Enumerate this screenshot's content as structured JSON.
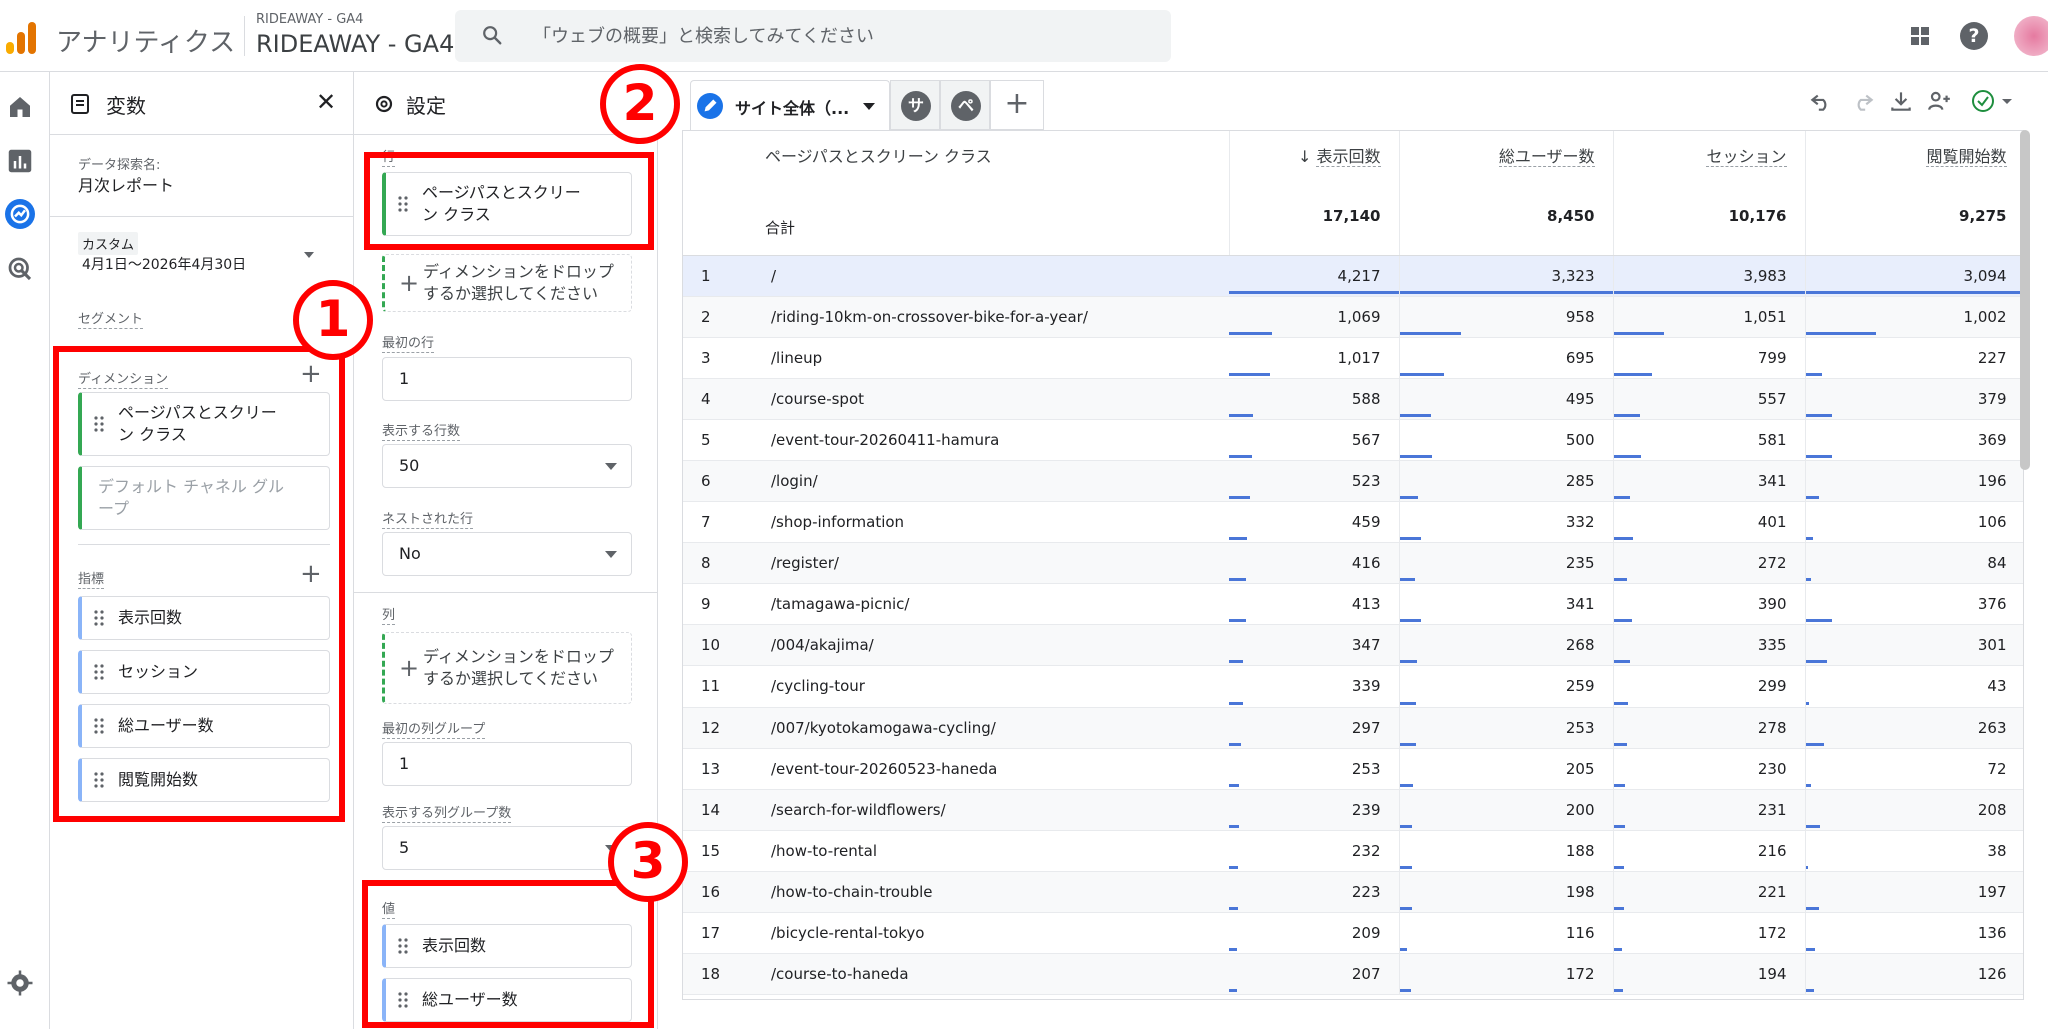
{
  "header": {
    "product_name": "アナリティクス",
    "property_small": "RIDEAWAY - GA4",
    "property_big": "RIDEAWAY - GA4",
    "search_placeholder": "「ウェブの概要」と検索してみてください",
    "help_glyph": "?",
    "logo_colors": [
      "#f9ab00",
      "#e37400",
      "#e37400"
    ]
  },
  "variables": {
    "title": "変数",
    "close_glyph": "✕",
    "exploration_name_label": "データ探索名:",
    "exploration_name": "月次レポート",
    "date_label": "カスタム",
    "date_range": "4月1日〜2026年4月30日",
    "segment_label": "セグメント",
    "dimensions_label": "ディメンション",
    "dimensions": [
      "ページパスとスクリー\nン クラス",
      "デフォルト チャネル グル\nープ"
    ],
    "metrics_label": "指標",
    "metrics": [
      "表示回数",
      "セッション",
      "総ユーザー数",
      "閲覧開始数"
    ]
  },
  "settings": {
    "title": "設定",
    "rows_label": "行",
    "rows_chip": "ページパスとスクリー\nン クラス",
    "drop_text": "ディメンションをドロップ\nするか選択してください",
    "first_row_label": "最初の行",
    "first_row_value": "1",
    "show_rows_label": "表示する行数",
    "show_rows_value": "50",
    "nested_label": "ネストされた行",
    "nested_value": "No",
    "columns_label": "列",
    "columns_drop_text": "ディメンションをドロップ\nするか選択してください",
    "first_col_group_label": "最初の列グループ",
    "first_col_group_value": "1",
    "show_col_groups_label": "表示する列グループ数",
    "show_col_groups_value": "5",
    "values_label": "値",
    "values": [
      "表示回数",
      "総ユーザー数"
    ]
  },
  "annotations": {
    "badge1": "1",
    "badge2": "2",
    "badge3": "3",
    "color": "#ff0000"
  },
  "tabs": {
    "main_label": "サイト全体（...",
    "tab2_glyph": "サ",
    "tab3_glyph": "ペ",
    "add_glyph": "+"
  },
  "table": {
    "dimension_header": "ページパスとスクリーン クラス",
    "total_label": "合計",
    "metric_headers": [
      "表示回数",
      "総ユーザー数",
      "セッション",
      "閲覧開始数"
    ],
    "sort_arrow": "↓",
    "totals": [
      "17,140",
      "8,450",
      "10,176",
      "9,275"
    ],
    "rows": [
      {
        "i": "1",
        "path": "/",
        "v": [
          "4,217",
          "3,323",
          "3,983",
          "3,094"
        ]
      },
      {
        "i": "2",
        "path": "/riding-10km-on-crossover-bike-for-a-year/",
        "v": [
          "1,069",
          "958",
          "1,051",
          "1,002"
        ]
      },
      {
        "i": "3",
        "path": "/lineup",
        "v": [
          "1,017",
          "695",
          "799",
          "227"
        ]
      },
      {
        "i": "4",
        "path": "/course-spot",
        "v": [
          "588",
          "495",
          "557",
          "379"
        ]
      },
      {
        "i": "5",
        "path": "/event-tour-20260411-hamura",
        "v": [
          "567",
          "500",
          "581",
          "369"
        ]
      },
      {
        "i": "6",
        "path": "/login/",
        "v": [
          "523",
          "285",
          "341",
          "196"
        ]
      },
      {
        "i": "7",
        "path": "/shop-information",
        "v": [
          "459",
          "332",
          "401",
          "106"
        ]
      },
      {
        "i": "8",
        "path": "/register/",
        "v": [
          "416",
          "235",
          "272",
          "84"
        ]
      },
      {
        "i": "9",
        "path": "/tamagawa-picnic/",
        "v": [
          "413",
          "341",
          "390",
          "376"
        ]
      },
      {
        "i": "10",
        "path": "/004/akajima/",
        "v": [
          "347",
          "268",
          "335",
          "301"
        ]
      },
      {
        "i": "11",
        "path": "/cycling-tour",
        "v": [
          "339",
          "259",
          "299",
          "43"
        ]
      },
      {
        "i": "12",
        "path": "/007/kyotokamogawa-cycling/",
        "v": [
          "297",
          "253",
          "278",
          "263"
        ]
      },
      {
        "i": "13",
        "path": "/event-tour-20260523-haneda",
        "v": [
          "253",
          "205",
          "230",
          "72"
        ]
      },
      {
        "i": "14",
        "path": "/search-for-wildflowers/",
        "v": [
          "239",
          "200",
          "231",
          "208"
        ]
      },
      {
        "i": "15",
        "path": "/how-to-rental",
        "v": [
          "232",
          "188",
          "216",
          "38"
        ]
      },
      {
        "i": "16",
        "path": "/how-to-chain-trouble",
        "v": [
          "223",
          "198",
          "221",
          "197"
        ]
      },
      {
        "i": "17",
        "path": "/bicycle-rental-tokyo",
        "v": [
          "209",
          "116",
          "172",
          "136"
        ]
      },
      {
        "i": "18",
        "path": "/course-to-haneda",
        "v": [
          "207",
          "172",
          "194",
          "126"
        ]
      }
    ]
  },
  "colors": {
    "accent": "#1a73e8",
    "bar": "#4a76d8",
    "dimension_chip": "#34a853",
    "metric_chip": "#8ab4f8"
  }
}
